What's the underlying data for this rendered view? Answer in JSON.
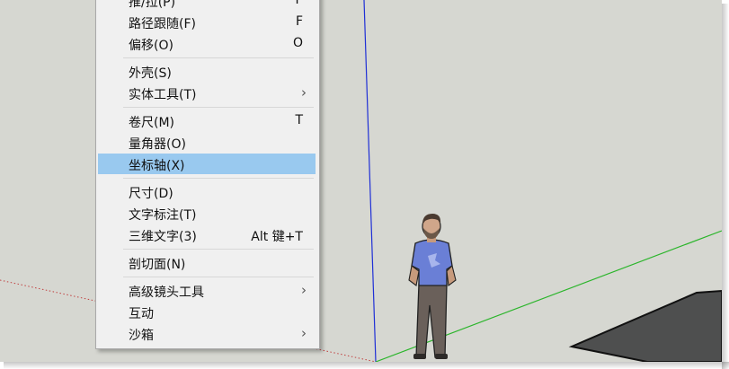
{
  "menu": {
    "items": [
      {
        "label": "推/拉(P)",
        "shortcut": "P",
        "submenu": false,
        "highlighted": false
      },
      {
        "label": "路径跟随(F)",
        "shortcut": "F",
        "submenu": false,
        "highlighted": false
      },
      {
        "label": "偏移(O)",
        "shortcut": "O",
        "submenu": false,
        "highlighted": false
      },
      {
        "label": "外壳(S)",
        "shortcut": "",
        "submenu": false,
        "highlighted": false
      },
      {
        "label": "实体工具(T)",
        "shortcut": "",
        "submenu": true,
        "highlighted": false
      },
      {
        "label": "卷尺(M)",
        "shortcut": "T",
        "submenu": false,
        "highlighted": false
      },
      {
        "label": "量角器(O)",
        "shortcut": "",
        "submenu": false,
        "highlighted": false
      },
      {
        "label": "坐标轴(X)",
        "shortcut": "",
        "submenu": false,
        "highlighted": true
      },
      {
        "label": "尺寸(D)",
        "shortcut": "",
        "submenu": false,
        "highlighted": false
      },
      {
        "label": "文字标注(T)",
        "shortcut": "",
        "submenu": false,
        "highlighted": false
      },
      {
        "label": "三维文字(3)",
        "shortcut": "Alt 键+T",
        "submenu": false,
        "highlighted": false
      },
      {
        "label": "剖切面(N)",
        "shortcut": "",
        "submenu": false,
        "highlighted": false
      },
      {
        "label": "高级镜头工具",
        "shortcut": "",
        "submenu": true,
        "highlighted": false
      },
      {
        "label": "互动",
        "shortcut": "",
        "submenu": false,
        "highlighted": false
      },
      {
        "label": "沙箱",
        "shortcut": "",
        "submenu": true,
        "highlighted": false
      }
    ],
    "submenu_arrow": "›"
  },
  "colors": {
    "viewport_bg": "#d6d7d1",
    "menu_bg": "#f0f0f0",
    "highlight": "#99c9ef",
    "axis_blue": "#1f2fd6",
    "axis_green": "#2bb52b",
    "axis_red_dotted": "#c04040"
  }
}
